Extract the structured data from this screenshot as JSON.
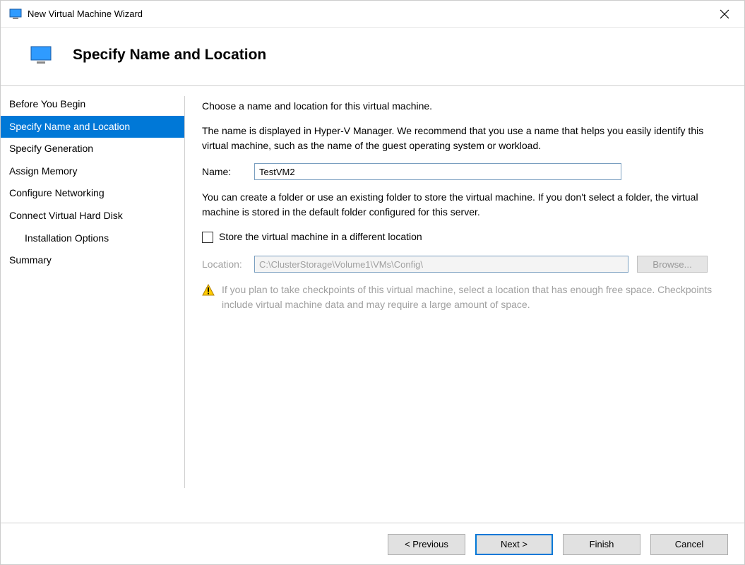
{
  "window": {
    "title": "New Virtual Machine Wizard"
  },
  "header": {
    "title": "Specify Name and Location"
  },
  "sidebar": {
    "steps": [
      "Before You Begin",
      "Specify Name and Location",
      "Specify Generation",
      "Assign Memory",
      "Configure Networking",
      "Connect Virtual Hard Disk",
      "Installation Options",
      "Summary"
    ],
    "active_index": 1,
    "indent_index": 6
  },
  "main": {
    "intro": "Choose a name and location for this virtual machine.",
    "name_desc": "The name is displayed in Hyper-V Manager. We recommend that you use a name that helps you easily identify this virtual machine, such as the name of the guest operating system or workload.",
    "name_label": "Name:",
    "name_value": "TestVM2",
    "folder_desc": "You can create a folder or use an existing folder to store the virtual machine. If you don't select a folder, the virtual machine is stored in the default folder configured for this server.",
    "checkbox_label": "Store the virtual machine in a different location",
    "location_label": "Location:",
    "location_value": "C:\\ClusterStorage\\Volume1\\VMs\\Config\\",
    "browse_label": "Browse...",
    "warning_text": "If you plan to take checkpoints of this virtual machine, select a location that has enough free space. Checkpoints include virtual machine data and may require a large amount of space."
  },
  "footer": {
    "previous": "< Previous",
    "next": "Next >",
    "finish": "Finish",
    "cancel": "Cancel"
  }
}
